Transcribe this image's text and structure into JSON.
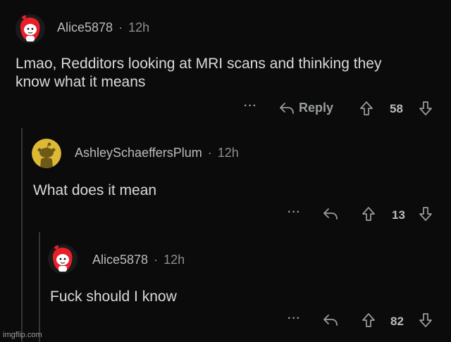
{
  "comments": [
    {
      "username": "Alice5878",
      "separator": "·",
      "time": "12h",
      "body_line1": "Lmao, Redditors looking at MRI scans and thinking they",
      "body_line2": "know what it means",
      "more": "···",
      "reply_label": "Reply",
      "score": "58",
      "avatar_icon": "snoo-red-hair-avatar-icon"
    },
    {
      "username": "AshleySchaeffersPlum",
      "separator": "·",
      "time": "12h",
      "body": "What does it mean",
      "more": "···",
      "score": "13",
      "avatar_icon": "snoo-default-yellow-avatar-icon"
    },
    {
      "username": "Alice5878",
      "separator": "·",
      "time": "12h",
      "body": "Fuck should I know",
      "more": "···",
      "score": "82",
      "avatar_icon": "snoo-red-hair-avatar-icon"
    }
  ],
  "watermark": "imgflip.com",
  "colors": {
    "background": "#0b0b0b",
    "text": "#d7dadc",
    "muted": "#8b8e91",
    "avatar_red": "#e8202a",
    "avatar_yellow": "#ddb935"
  }
}
